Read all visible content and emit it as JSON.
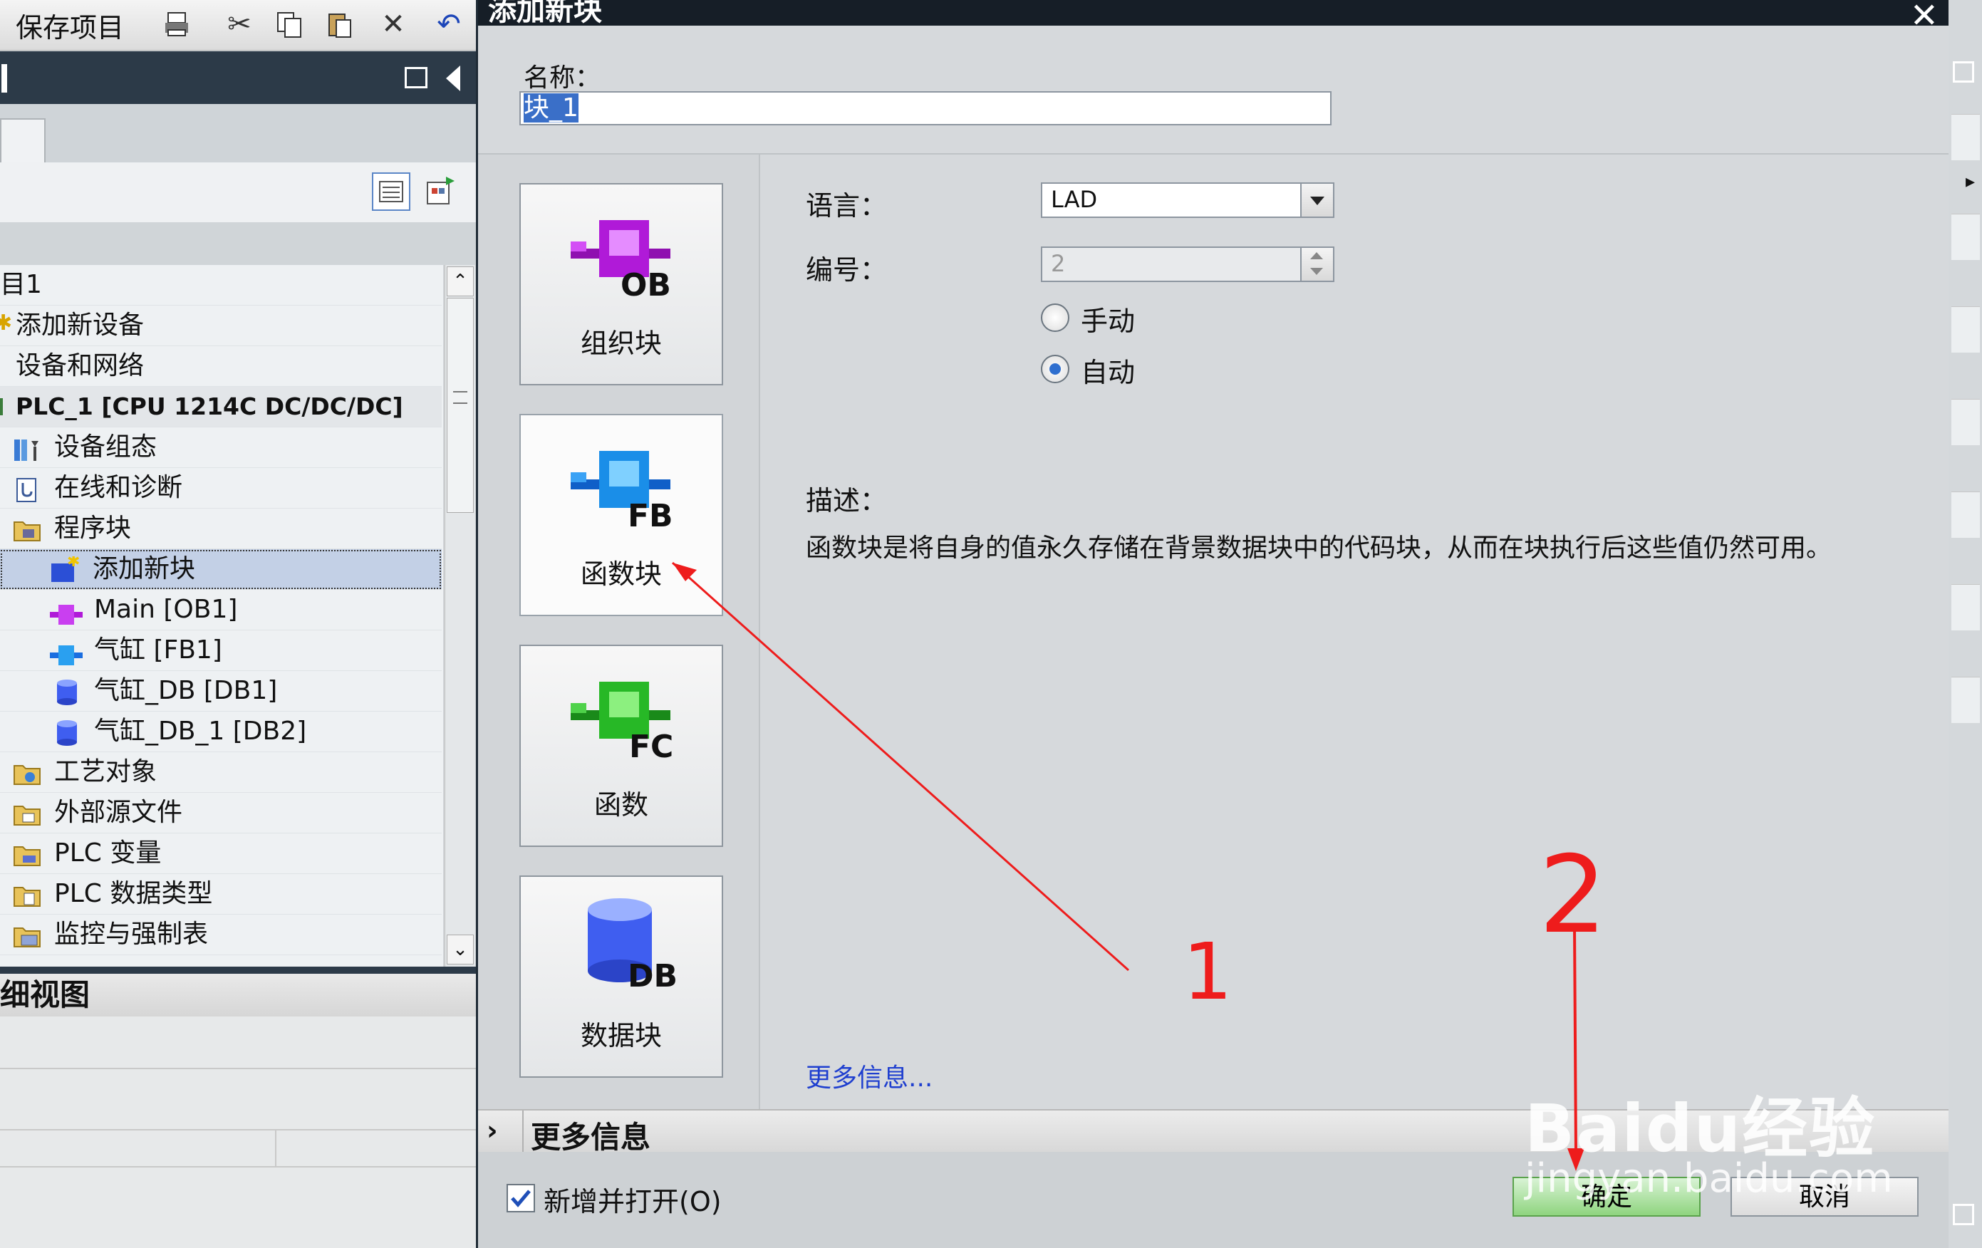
{
  "toolbar": {
    "save_label": "保存项目"
  },
  "tree": {
    "items": [
      {
        "label": "目1"
      },
      {
        "label": "添加新设备"
      },
      {
        "label": "设备和网络"
      },
      {
        "label": "PLC_1 [CPU 1214C DC/DC/DC]"
      },
      {
        "label": "设备组态"
      },
      {
        "label": "在线和诊断"
      },
      {
        "label": "程序块"
      },
      {
        "label": "添加新块"
      },
      {
        "label": "Main [OB1]"
      },
      {
        "label": "气缸 [FB1]"
      },
      {
        "label": "气缸_DB [DB1]"
      },
      {
        "label": "气缸_DB_1 [DB2]"
      },
      {
        "label": "工艺对象"
      },
      {
        "label": "外部源文件"
      },
      {
        "label": "PLC 变量"
      },
      {
        "label": "PLC 数据类型"
      },
      {
        "label": "监控与强制表"
      }
    ]
  },
  "detail": {
    "title": "细视图"
  },
  "dialog": {
    "title": "添加新块",
    "name_label": "名称：",
    "name_value": "块_1",
    "blocks": [
      {
        "label": "组织块",
        "code": "OB",
        "color": "#b01ad8"
      },
      {
        "label": "函数块",
        "code": "FB",
        "color": "#1a8ee8"
      },
      {
        "label": "函数",
        "code": "FC",
        "color": "#27b826"
      },
      {
        "label": "数据块",
        "code": "DB",
        "color": "#3f5ef0"
      }
    ],
    "language_label": "语言：",
    "language_value": "LAD",
    "number_label": "编号：",
    "number_value": "2",
    "radio_manual": "手动",
    "radio_auto": "自动",
    "desc_label": "描述：",
    "desc_text": "函数块是将自身的值永久存储在背景数据块中的代码块，从而在块执行后这些值仍然可用。",
    "more_info_link": "更多信息...",
    "more_info_bar": "更多信息",
    "checkbox_label": "新增并打开(O)",
    "ok_label": "确定",
    "cancel_label": "取消"
  },
  "annotations": {
    "mark1": "1",
    "mark2": "2"
  },
  "watermark": {
    "line1": "Baidu经验",
    "line2": "jingyan.baidu.com"
  },
  "colors": {
    "accent": "#2f6fcf",
    "annotation": "#ee1c1c",
    "ok_button": "#8fd47f"
  }
}
